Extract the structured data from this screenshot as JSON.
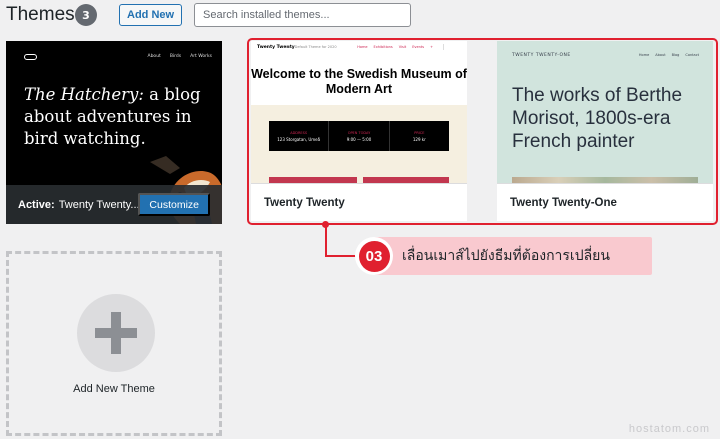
{
  "header": {
    "title": "Themes",
    "count": "3",
    "add_new_label": "Add New",
    "search_placeholder": "Search installed themes..."
  },
  "themes": {
    "active": {
      "preview_brand_icon": "hatchery-logo-icon",
      "preview_nav": [
        "About",
        "Birds",
        "Art Works"
      ],
      "preview_title_italic": "The Hatchery:",
      "preview_title_rest": " a blog about adventures in bird watching.",
      "active_label": "Active:",
      "name": "Twenty Twenty...",
      "customize_label": "Customize"
    },
    "twenty_twenty": {
      "preview_brand": "Twenty Twenty",
      "preview_desc": "The Default Theme for 2020",
      "preview_menu": [
        "Home",
        "Exhibitions",
        "Visit",
        "Events",
        "+"
      ],
      "preview_headline": "Welcome to the Swedish Museum of Modern Art",
      "preview_band": [
        {
          "label": "ADDRESS",
          "value": "123 Storgatan, Umeå"
        },
        {
          "label": "OPEN TODAY",
          "value": "9:00 — 5:00"
        },
        {
          "label": "PRICE",
          "value": "129 kr"
        }
      ],
      "name": "Twenty Twenty"
    },
    "twenty_twenty_one": {
      "preview_brand": "TWENTY TWENTY-ONE",
      "preview_menu": [
        "Home",
        "About",
        "Blog",
        "Contact"
      ],
      "preview_headline": "The works of Berthe Morisot, 1800s-era French painter",
      "name": "Twenty Twenty-One"
    }
  },
  "add_theme": {
    "label": "Add New Theme"
  },
  "annotation": {
    "step": "03",
    "text": "เลื่อนเมาส์ไปยังธีมที่ต้องการเปลี่ยน"
  },
  "watermark": "hostatom.com",
  "colors": {
    "accent": "#2271b1",
    "highlight": "#e0202f",
    "callout_bg": "#f9c9cf",
    "tt_accent": "#cd2653",
    "tto_bg": "#d1e4dd"
  }
}
